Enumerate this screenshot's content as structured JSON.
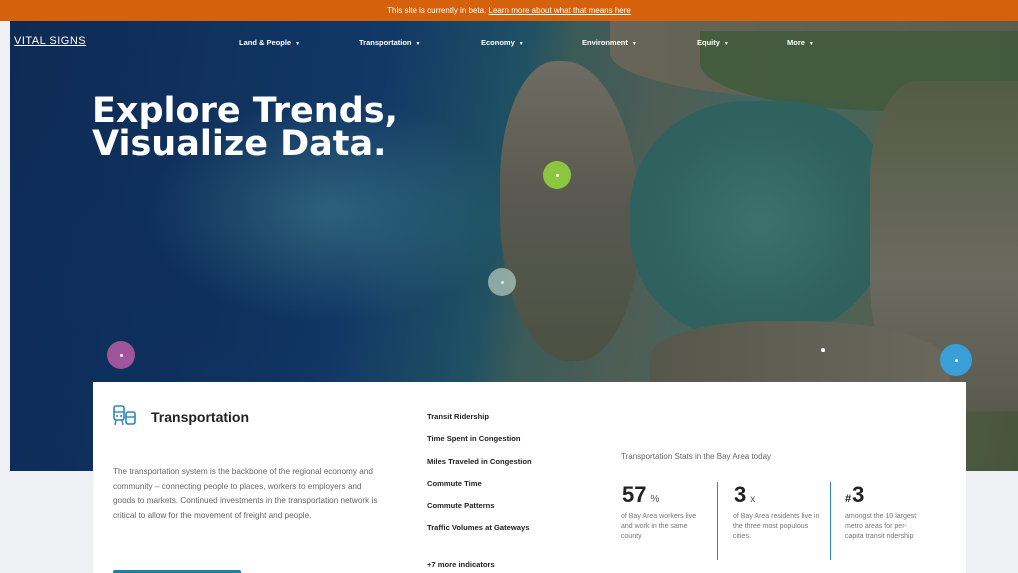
{
  "beta_banner": {
    "text": "This site is currently in beta.",
    "link": "Learn more about what that means here"
  },
  "nav": {
    "logo": "VITAL SIGNS",
    "items": [
      {
        "label": "Land & People"
      },
      {
        "label": "Transportation"
      },
      {
        "label": "Economy"
      },
      {
        "label": "Environment"
      },
      {
        "label": "Equity"
      },
      {
        "label": "More"
      }
    ]
  },
  "hero": {
    "headline_line1": "Explore Trends,",
    "headline_line2": "Visualize Data."
  },
  "colors": {
    "beta_bar": "#d5610c",
    "accent_blue": "#2c85bd",
    "marker_green": "#8cc63f",
    "marker_teal": "#9fb8b0",
    "marker_purple": "#a0559b",
    "marker_blue": "#3a9ed8"
  },
  "card": {
    "title": "Transportation",
    "icon": "transit-icon",
    "description": "The transportation system is the backbone of the regional economy and community – connecting people to places, workers to employers and goods to markets. Continued investments in the transportation network is critical to allow for the movement of freight and people.",
    "indicators": [
      "Transit Ridership",
      "Time Spent in Congestion",
      "Miles Traveled in Congestion",
      "Commute Time",
      "Commute Patterns",
      "Traffic Volumes at Gateways"
    ],
    "more_indicators": "+7 more indicators",
    "stats_title": "Transportation Stats in the Bay Area today",
    "stats": [
      {
        "prefix": "",
        "value": "57",
        "unit": "%",
        "caption": "of Bay Area workers live and work in the same county"
      },
      {
        "prefix": "",
        "value": "3",
        "unit": "x",
        "caption": "of Bay Area residents live in the three most populous cities."
      },
      {
        "prefix": "#",
        "value": "3",
        "unit": "",
        "caption": "amongst the 10 largest metro areas for per-capita transit ridership"
      }
    ]
  }
}
